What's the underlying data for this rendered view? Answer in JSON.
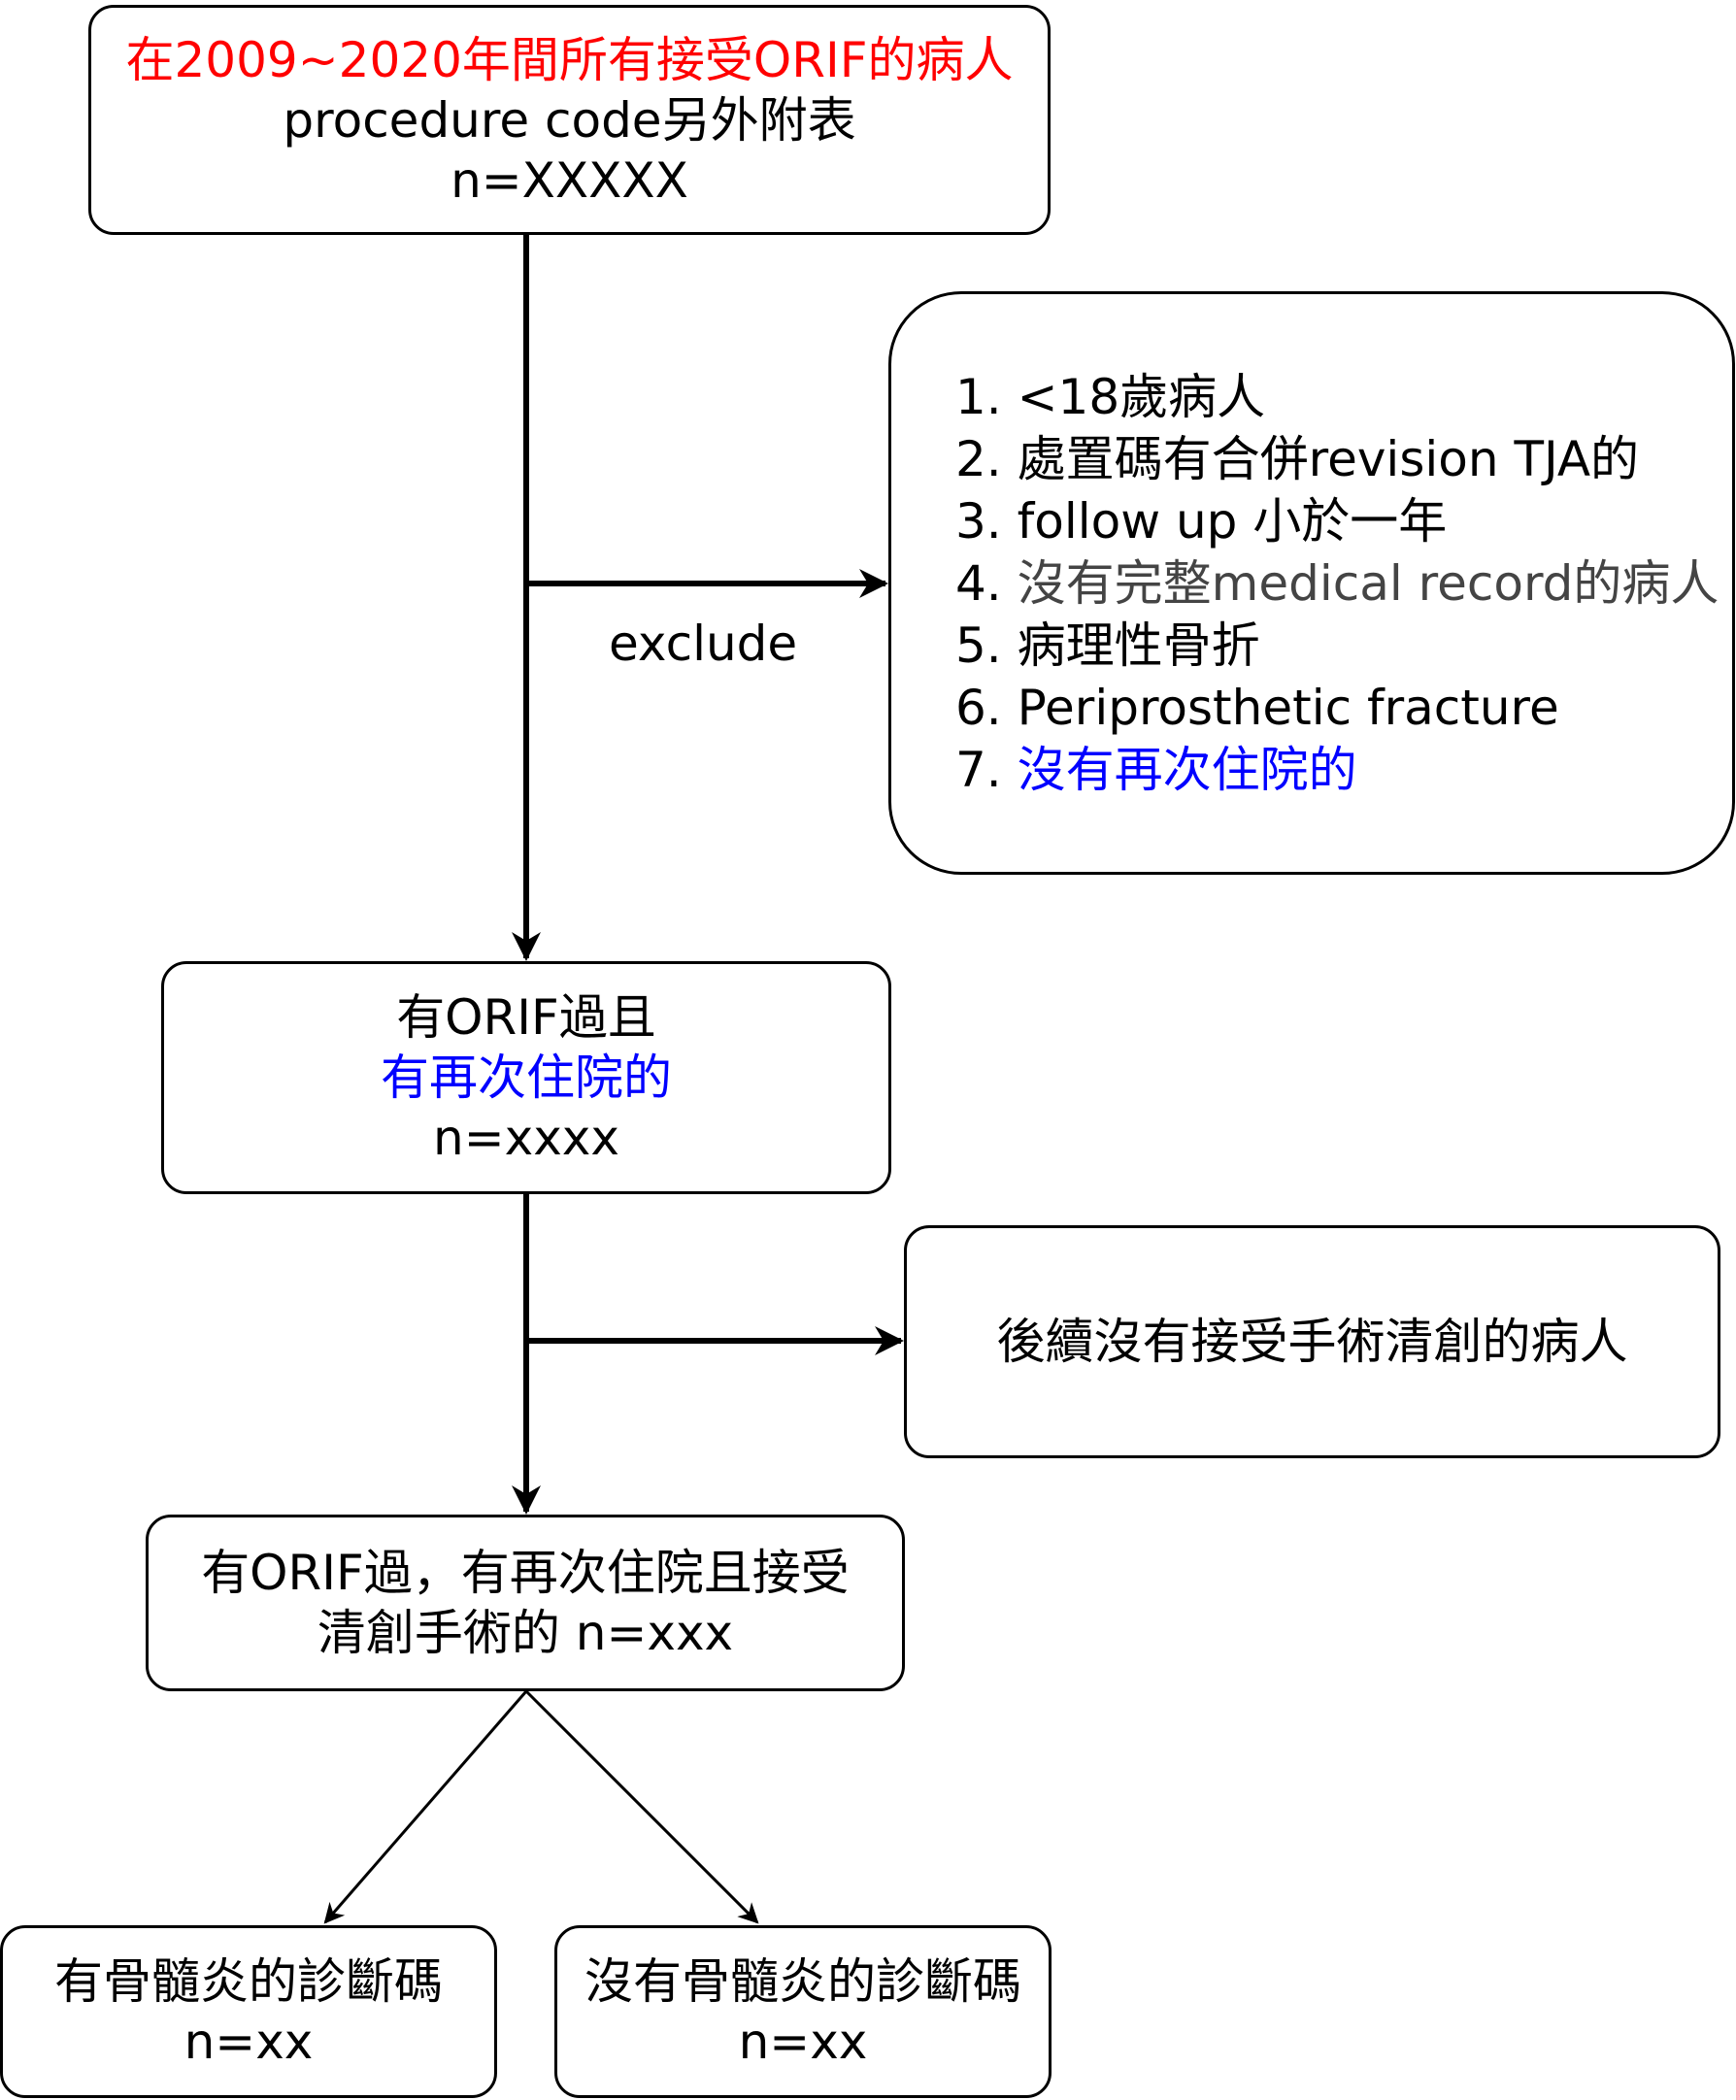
{
  "boxes": {
    "top": {
      "line1": "在2009~2020年間所有接受ORIF的病人",
      "line2": "procedure code另外附表",
      "line3": "n=XXXXX"
    },
    "exclusions": {
      "items": [
        {
          "number": "1.",
          "text": "<18歲病人"
        },
        {
          "number": "2.",
          "text": "處置碼有合併revision TJA的"
        },
        {
          "number": "3.",
          "text": "follow up 小於一年"
        },
        {
          "number": "4.",
          "text": "沒有完整medical record的病人"
        },
        {
          "number": "5.",
          "text": "病理性骨折"
        },
        {
          "number": "6.",
          "text": "Periprosthetic fracture"
        },
        {
          "number": "7.",
          "text": "沒有再次住院的"
        }
      ]
    },
    "readmitted": {
      "line1": "有ORIF過且",
      "line2": "有再次住院的",
      "line3": "n=xxxx"
    },
    "no_debridement": {
      "line1": "後續沒有接受手術清創的病人"
    },
    "debrided": {
      "line1": "有ORIF過，有再次住院且接受",
      "line2": "清創手術的 n=xxx"
    },
    "osteomyelitis_yes": {
      "line1": "有骨髓炎的診斷碼",
      "line2": "n=xx"
    },
    "osteomyelitis_no": {
      "line1": "沒有骨髓炎的診斷碼",
      "line2": "n=xx"
    }
  },
  "edge_labels": {
    "exclude": "exclude"
  },
  "colors": {
    "highlight_red": "#ff0000",
    "highlight_blue": "#0000ff",
    "muted_grey": "#444444",
    "stroke": "#000000"
  }
}
